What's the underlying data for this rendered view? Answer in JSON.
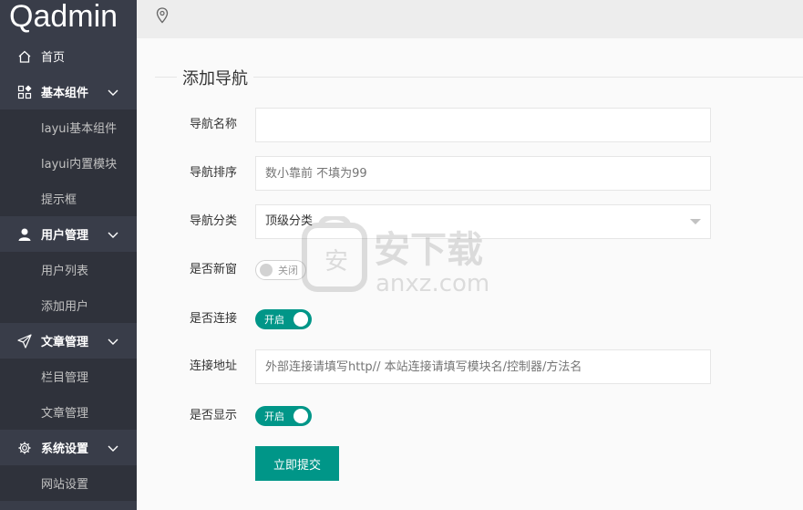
{
  "app": {
    "logo": "Qadmin"
  },
  "sidebar": {
    "items": [
      {
        "label": "首页",
        "icon": "home-icon",
        "type": "top-plain"
      },
      {
        "label": "基本组件",
        "icon": "components-icon",
        "type": "top"
      },
      {
        "label": "layui基本组件",
        "type": "sub"
      },
      {
        "label": "layui内置模块",
        "type": "sub"
      },
      {
        "label": "提示框",
        "type": "sub"
      },
      {
        "label": "用户管理",
        "icon": "user-icon",
        "type": "top"
      },
      {
        "label": "用户列表",
        "type": "sub"
      },
      {
        "label": "添加用户",
        "type": "sub"
      },
      {
        "label": "文章管理",
        "icon": "paper-plane-icon",
        "type": "top"
      },
      {
        "label": "栏目管理",
        "type": "sub"
      },
      {
        "label": "文章管理",
        "type": "sub"
      },
      {
        "label": "系统设置",
        "icon": "gear-icon",
        "type": "top"
      },
      {
        "label": "网站设置",
        "type": "sub"
      }
    ]
  },
  "form": {
    "title": "添加导航",
    "nav_name": {
      "label": "导航名称",
      "value": "",
      "placeholder": ""
    },
    "nav_sort": {
      "label": "导航排序",
      "value": "",
      "placeholder": "数小靠前 不填为99"
    },
    "nav_category": {
      "label": "导航分类",
      "selected": "顶级分类"
    },
    "new_window": {
      "label": "是否新窗",
      "state": "关闭",
      "on": false
    },
    "is_link": {
      "label": "是否连接",
      "state": "开启",
      "on": true
    },
    "link_url": {
      "label": "连接地址",
      "value": "",
      "placeholder": "外部连接请填写http// 本站连接请填写模块名/控制器/方法名"
    },
    "is_show": {
      "label": "是否显示",
      "state": "开启",
      "on": true
    },
    "submit_label": "立即提交"
  },
  "watermark": {
    "text": "安下载",
    "subtext": "anxz.com"
  },
  "colors": {
    "sidebar": "#393d49",
    "submenu": "#2f323b",
    "accent": "#009688"
  }
}
